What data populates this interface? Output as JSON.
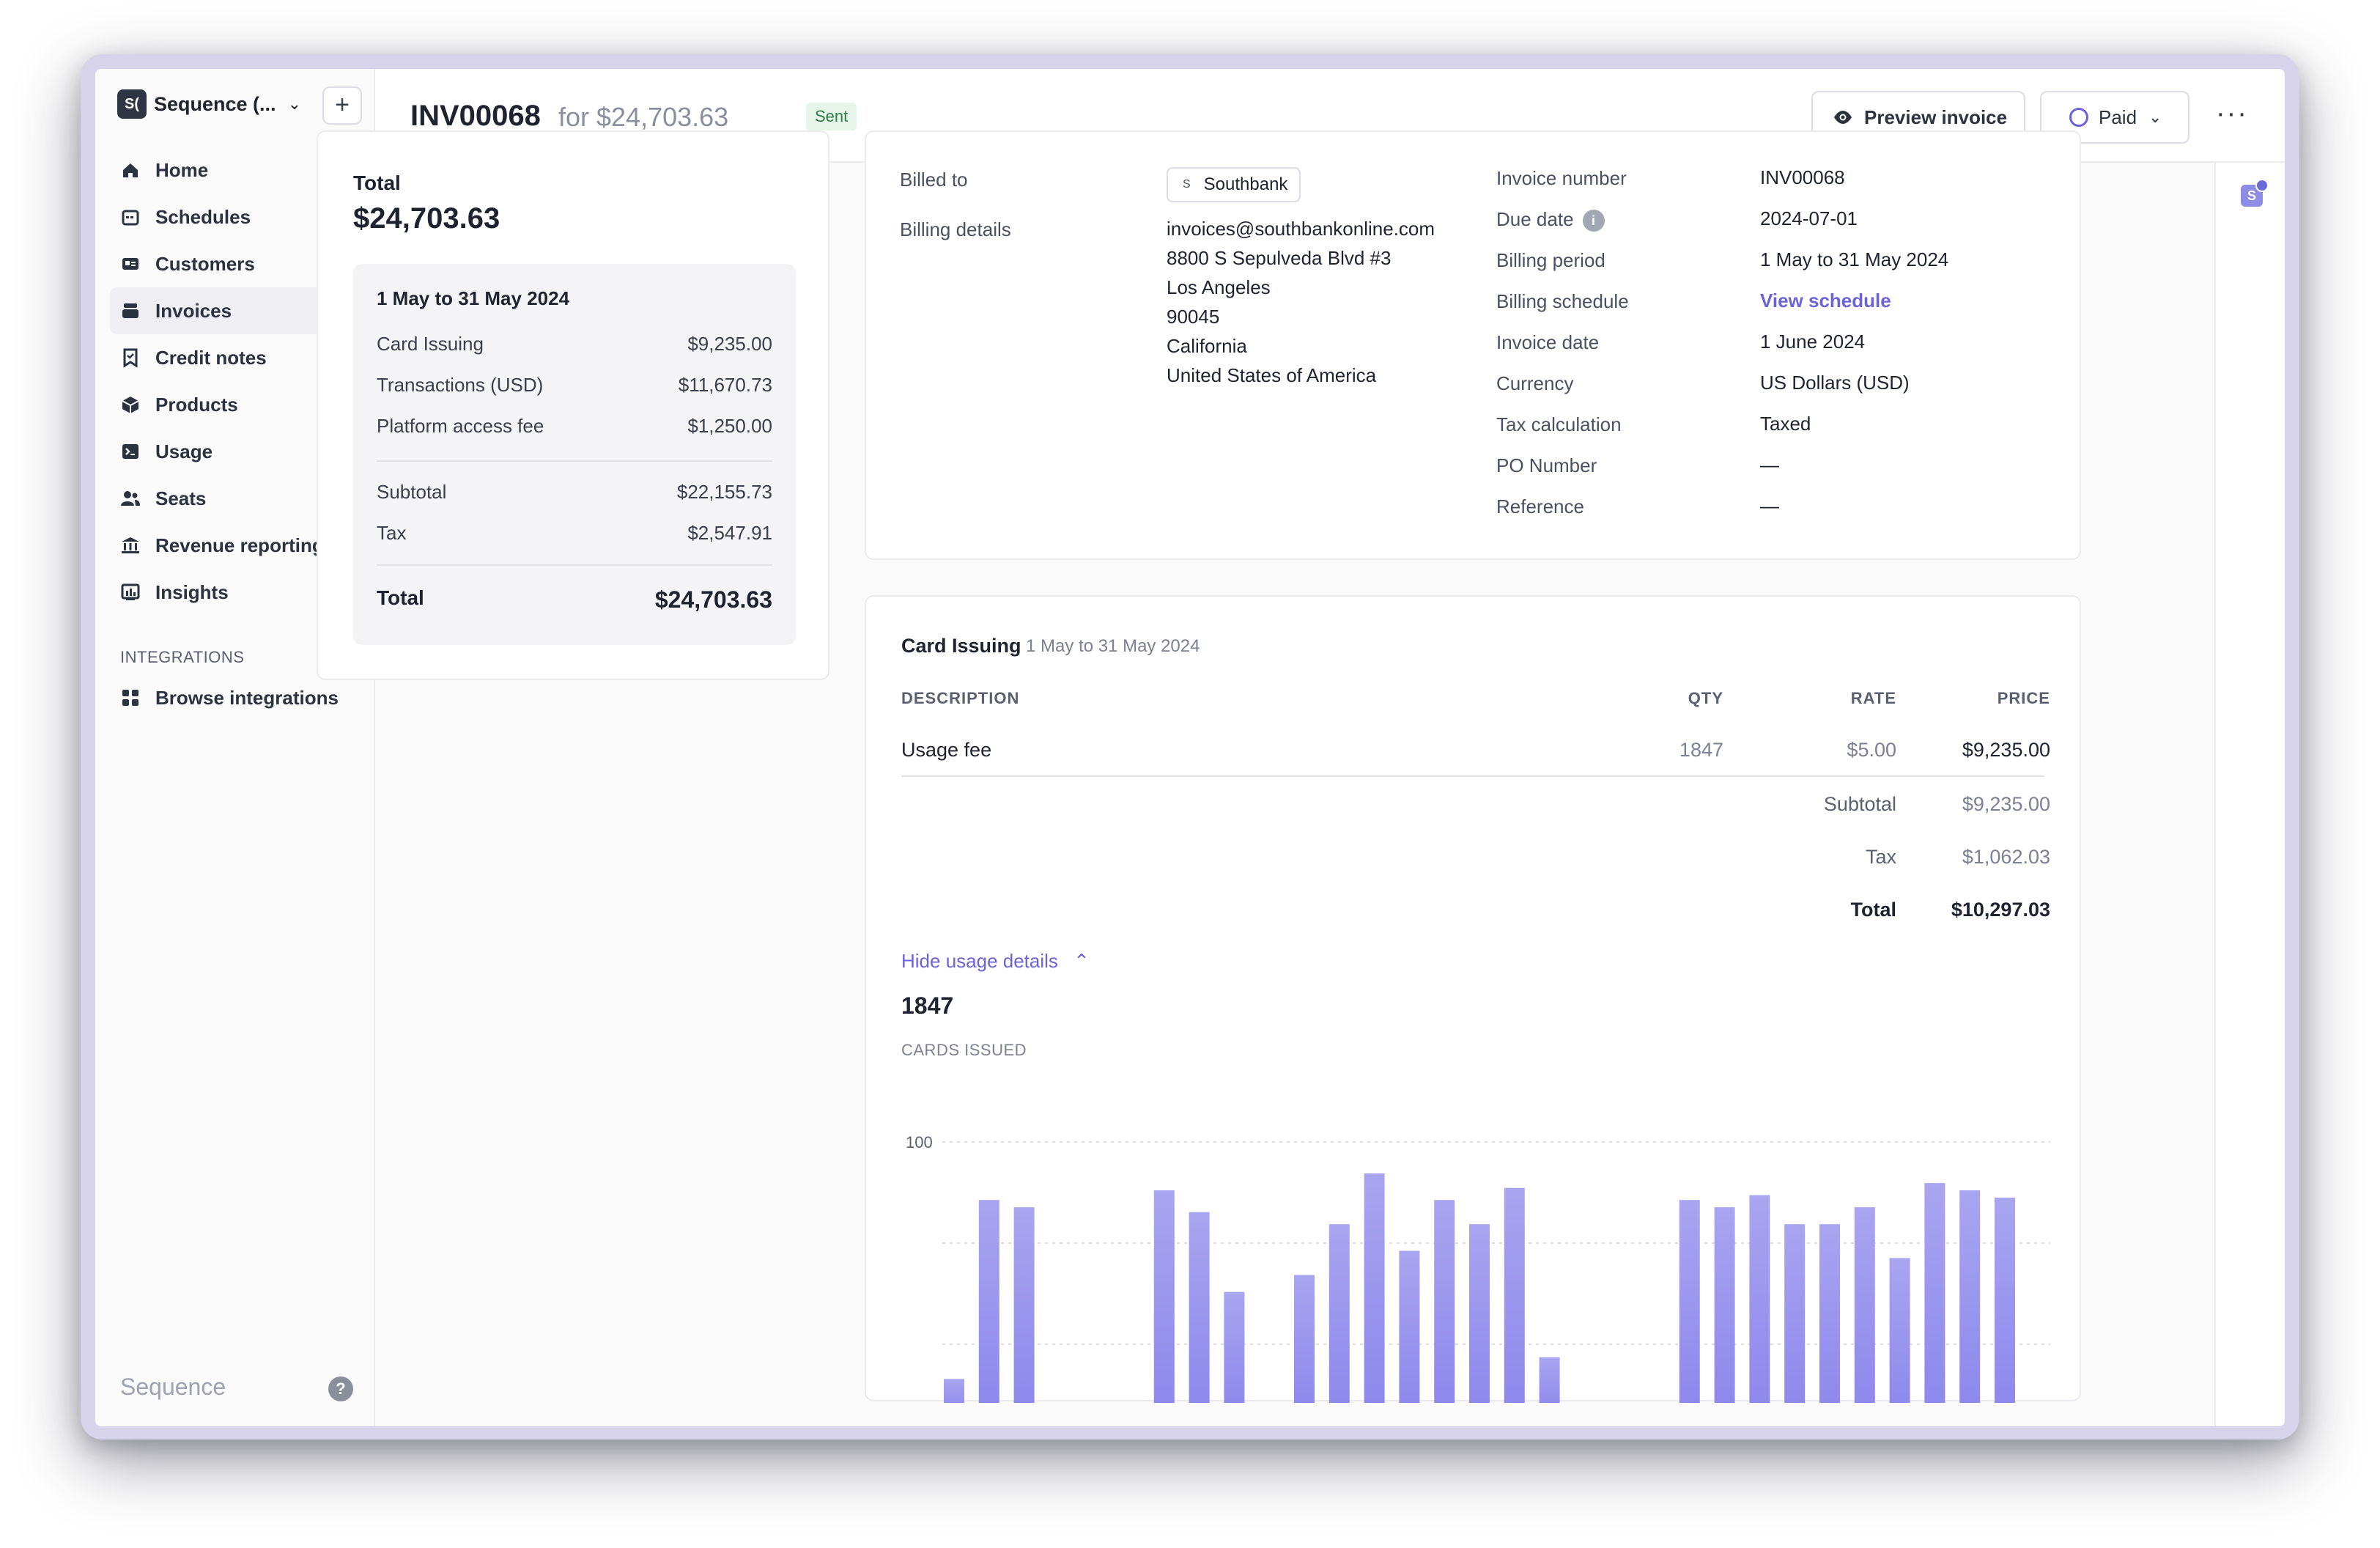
{
  "sidebar": {
    "org_logo": "S(",
    "org_name": "Sequence (...",
    "add_label": "+",
    "items": [
      {
        "label": "Home",
        "icon": "home-icon"
      },
      {
        "label": "Schedules",
        "icon": "calendar-icon"
      },
      {
        "label": "Customers",
        "icon": "id-card-icon"
      },
      {
        "label": "Invoices",
        "icon": "invoice-icon",
        "active": true
      },
      {
        "label": "Credit notes",
        "icon": "credit-note-icon"
      },
      {
        "label": "Products",
        "icon": "cube-icon"
      },
      {
        "label": "Usage",
        "icon": "terminal-icon",
        "expandable": true
      },
      {
        "label": "Seats",
        "icon": "users-icon",
        "expandable": true
      },
      {
        "label": "Revenue reporting",
        "icon": "bank-icon",
        "expandable": true
      },
      {
        "label": "Insights",
        "icon": "insights-icon"
      }
    ],
    "integrations_title": "INTEGRATIONS",
    "integrations_items": [
      {
        "label": "Browse integrations",
        "icon": "grid-icon"
      }
    ],
    "brand": "Sequence",
    "help": "?"
  },
  "header": {
    "invoice_id": "INV00068",
    "for_amount": "for $24,703.63",
    "status": "Sent",
    "preview_label": "Preview invoice",
    "paid_label": "Paid",
    "more": "···"
  },
  "summary": {
    "total_label": "Total",
    "total_amount": "$24,703.63",
    "period": "1 May to 31 May 2024",
    "lines": [
      {
        "label": "Card Issuing",
        "value": "$9,235.00"
      },
      {
        "label": "Transactions (USD)",
        "value": "$11,670.73"
      },
      {
        "label": "Platform access fee",
        "value": "$1,250.00"
      }
    ],
    "subtotal_label": "Subtotal",
    "subtotal": "$22,155.73",
    "tax_label": "Tax",
    "tax": "$2,547.91",
    "grand_total_label": "Total",
    "grand_total": "$24,703.63"
  },
  "details": {
    "billed_to_label": "Billed to",
    "billed_to_chip_icon": "S",
    "billed_to": "Southbank",
    "billing_details_label": "Billing details",
    "billing_lines": [
      "invoices@southbankonline.com",
      "8800 S Sepulveda Blvd #3",
      "Los Angeles",
      "90045",
      "California",
      "United States of America"
    ],
    "fields": [
      {
        "label": "Invoice number",
        "value": "INV00068"
      },
      {
        "label": "Due date",
        "value": "2024-07-01",
        "info": true
      },
      {
        "label": "Billing period",
        "value": "1 May to 31 May 2024"
      },
      {
        "label": "Billing schedule",
        "value": "View schedule",
        "link": true
      },
      {
        "label": "Invoice date",
        "value": "1 June 2024"
      },
      {
        "label": "Currency",
        "value": "US Dollars (USD)"
      },
      {
        "label": "Tax calculation",
        "value": "Taxed"
      },
      {
        "label": "PO Number",
        "value": "—"
      },
      {
        "label": "Reference",
        "value": "—"
      }
    ]
  },
  "line_group": {
    "title": "Card Issuing",
    "period": "1 May to 31 May 2024",
    "columns": {
      "description": "DESCRIPTION",
      "qty": "QTY",
      "rate": "RATE",
      "price": "PRICE"
    },
    "row": {
      "description": "Usage fee",
      "qty": "1847",
      "rate": "$5.00",
      "price": "$9,235.00"
    },
    "subtotal_label": "Subtotal",
    "subtotal": "$9,235.00",
    "tax_label": "Tax",
    "tax": "$1,062.03",
    "total_label": "Total",
    "total": "$10,297.03",
    "hide_usage_label": "Hide usage details",
    "usage_value": "1847",
    "usage_label": "CARDS ISSUED"
  },
  "chart_data": {
    "type": "bar",
    "y_tick_labels": [
      "100"
    ],
    "ylim": [
      0,
      100
    ],
    "values": [
      2,
      76,
      73,
      0,
      0,
      0,
      80,
      71,
      38,
      0,
      45,
      66,
      87,
      55,
      76,
      66,
      81,
      11,
      0,
      0,
      0,
      76,
      73,
      78,
      66,
      66,
      73,
      52,
      83,
      80,
      77
    ],
    "color": "#8d87ec"
  }
}
